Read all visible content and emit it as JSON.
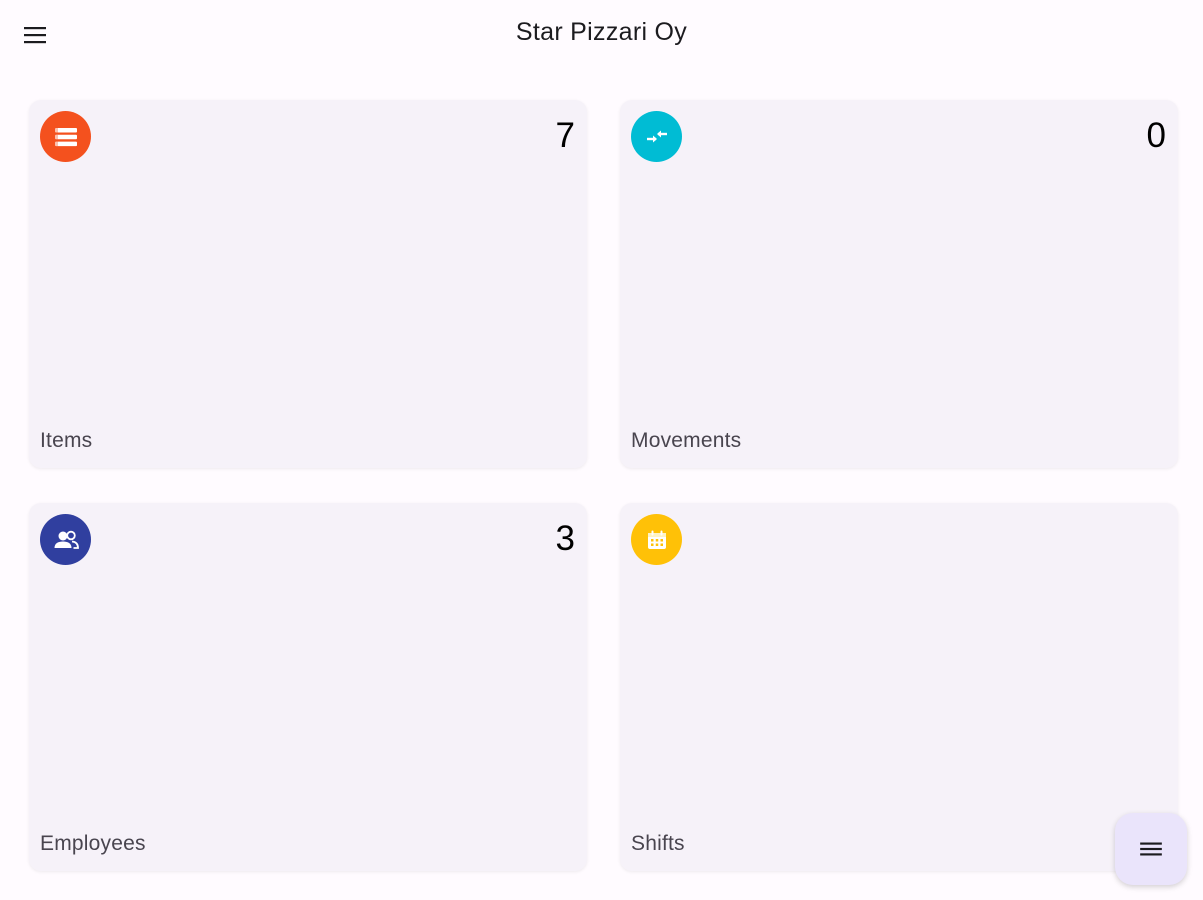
{
  "app_bar": {
    "title": "Star Pizzari Oy",
    "menu_icon": "menu-icon"
  },
  "cards": {
    "items": {
      "label": "Items",
      "count": "7",
      "icon": "list-icon",
      "color": "#f4511e"
    },
    "movements": {
      "label": "Movements",
      "count": "0",
      "icon": "swap-arrows-icon",
      "color": "#00bcd4"
    },
    "employees": {
      "label": "Employees",
      "count": "3",
      "icon": "people-icon",
      "color": "#303f9f"
    },
    "shifts": {
      "label": "Shifts",
      "count": "",
      "icon": "calendar-icon",
      "color": "#ffc107"
    }
  },
  "fab": {
    "icon": "menu-icon",
    "background": "#eae4fb"
  }
}
